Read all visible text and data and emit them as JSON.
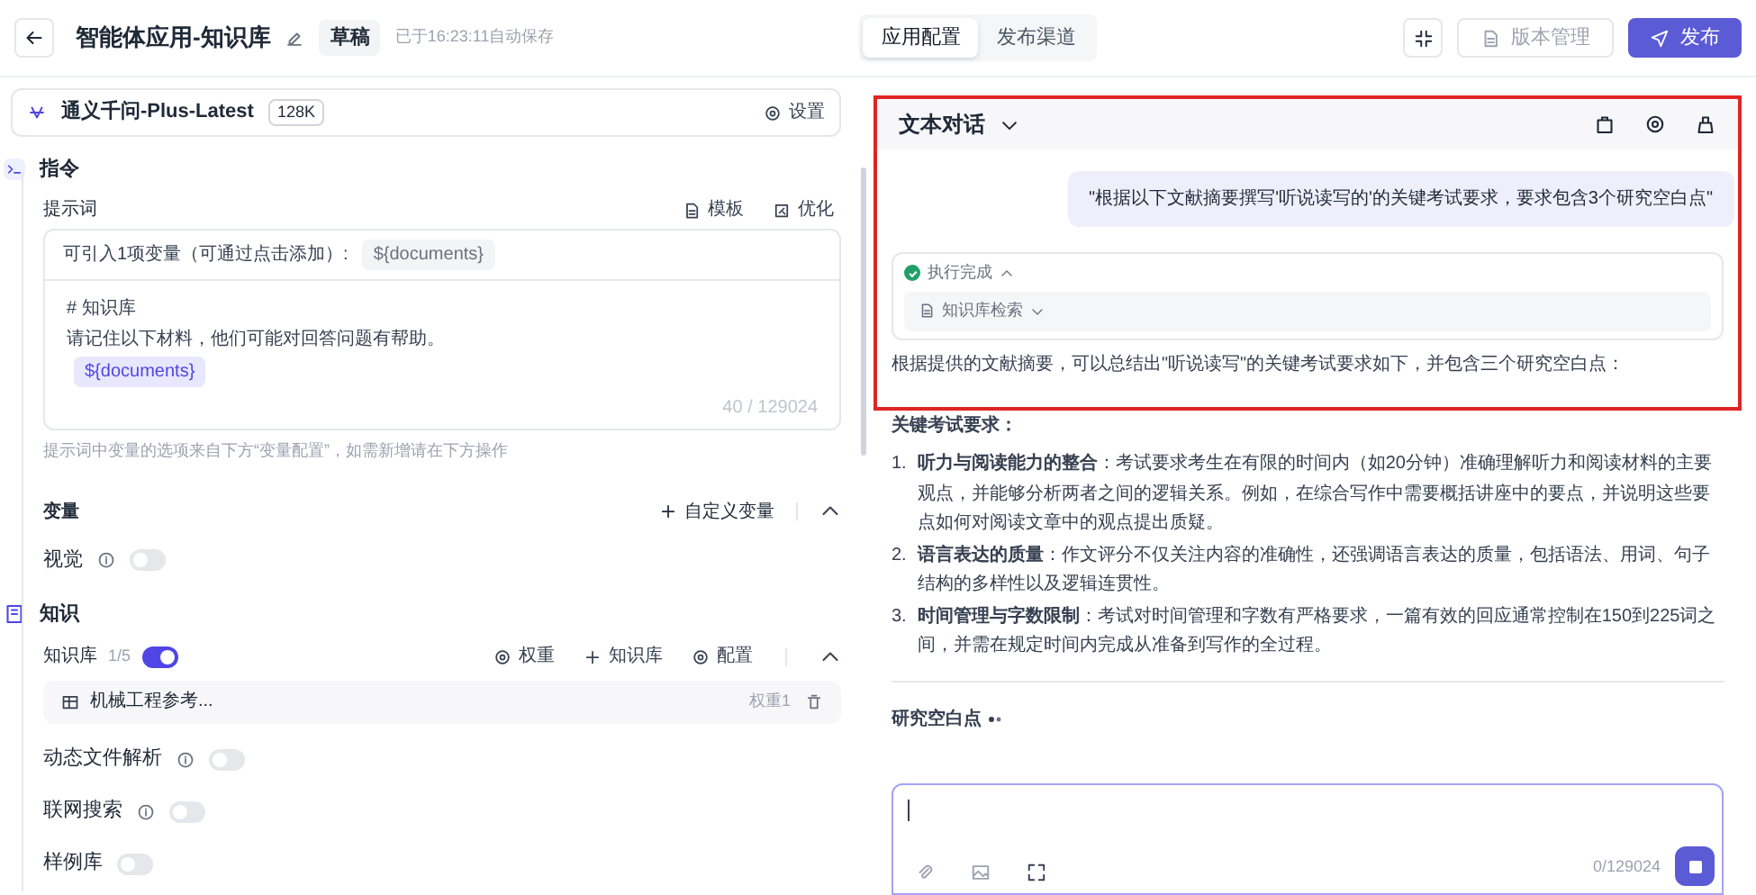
{
  "header": {
    "title": "智能体应用-知识库",
    "status_badge": "草稿",
    "save_note": "已于16:23:11自动保存",
    "tabs": [
      {
        "label": "应用配置",
        "selected": true
      },
      {
        "label": "发布渠道",
        "selected": false
      }
    ],
    "version_button": "版本管理",
    "publish_button": "发布"
  },
  "model": {
    "name": "通义千问-Plus-Latest",
    "context": "128K",
    "settings": "设置"
  },
  "instructions": {
    "title": "指令",
    "prompt_label": "提示词",
    "actions": [
      "模板",
      "优化"
    ],
    "variable_hint": "可引入1项变量（可通过点击添加）:",
    "variable_chip": "${documents}",
    "lines": [
      {
        "kind": "text",
        "text": "# 知识库"
      },
      {
        "kind": "text",
        "text": "请记住以下材料，他们可能对回答问题有帮助。"
      },
      {
        "kind": "chip",
        "text": "${documents}"
      }
    ],
    "counter": "40 / 129024",
    "footnote": "提示词中变量的选项来自下方“变量配置”，如需新增请在下方操作"
  },
  "variables": {
    "title": "变量",
    "add": "自定义变量",
    "expanded": true,
    "toggles": [
      {
        "label": "视觉",
        "info": true,
        "on": false
      }
    ]
  },
  "knowledge": {
    "title": "知识",
    "kb_label": "知识库",
    "kb_count": "1/5",
    "kb_on": true,
    "expanded": true,
    "actions": [
      "权重",
      "知识库",
      "配置"
    ],
    "items": [
      {
        "name": "机械工程参考...",
        "weight": "权重1"
      }
    ],
    "toggles": [
      {
        "label": "动态文件解析",
        "info": true,
        "on": false
      },
      {
        "label": "联网搜索",
        "info": true,
        "on": false
      },
      {
        "label": "样例库",
        "info": false,
        "on": false
      }
    ]
  },
  "chat": {
    "mode": "文本对话",
    "user_message": "\"根据以下文献摘要撰写'听说读写的'的关键考试要求，要求包含3个研究空白点\"",
    "run": {
      "status": "执行完成",
      "expanded": true,
      "step": "知识库检索"
    },
    "intro": "根据提供的文献摘要，可以总结出\"听说读写\"的关键考试要求如下，并包含三个研究空白点：",
    "heading": "关键考试要求：",
    "items": [
      {
        "number": "1.",
        "text": "**听力与阅读能力的整合**：考试要求考生在有限的时间内（如20分钟）准确理解听力和阅读材料的主要观点，并能够分析两者之间的逻辑关系。例如，在综合写作中需要概括讲座中的要点，并说明这些要点如何对阅读文章中的观点提出质疑。"
      },
      {
        "number": "2.",
        "text": "**语言表达的质量**：作文评分不仅关注内容的准确性，还强调语言表达的质量，包括语法、用词、句子结构的多样性以及逻辑连贯性。"
      },
      {
        "number": "3.",
        "text": "**时间管理与字数限制**：考试对时间管理和字数有严格要求，一篇有效的回应通常控制在150到225词之间，并需在规定时间内完成从准备到写作的全过程。"
      }
    ],
    "section2": "研究空白点",
    "input_counter": "0/129024"
  }
}
